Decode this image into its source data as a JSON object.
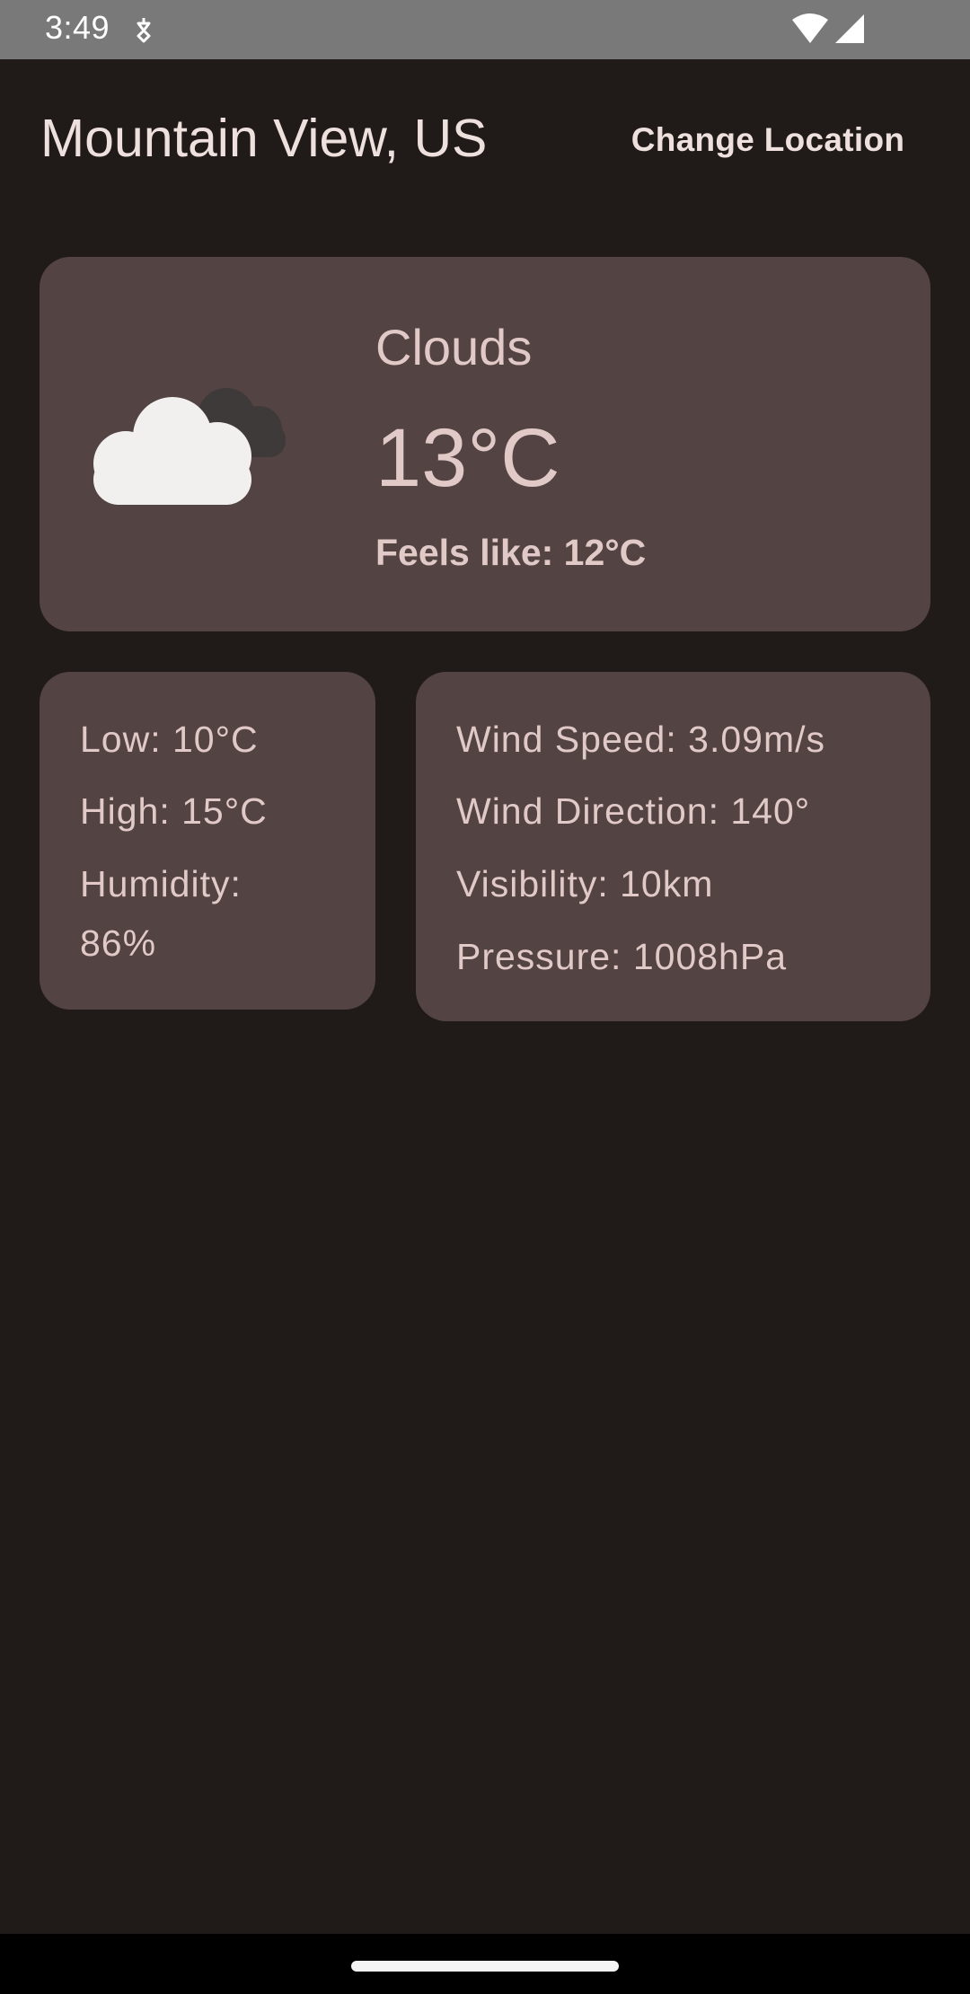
{
  "status_bar": {
    "time": "3:49",
    "icons": [
      "notification-icon",
      "wifi-icon",
      "signal-icon"
    ]
  },
  "header": {
    "location": "Mountain View, US",
    "change_location_label": "Change Location"
  },
  "current": {
    "icon": "clouds-icon",
    "condition": "Clouds",
    "temperature": "13°C",
    "feels_like": "Feels like: 12°C"
  },
  "details_left": {
    "low": "Low: 10°C",
    "high": "High: 15°C",
    "humidity_line1": "Humidity:",
    "humidity_line2": "86%"
  },
  "details_right": {
    "wind_speed": "Wind Speed: 3.09m/s",
    "wind_direction": "Wind Direction: 140°",
    "visibility": "Visibility: 10km",
    "pressure": "Pressure: 1008hPa"
  },
  "colors": {
    "background": "#201a19",
    "card": "#534342",
    "text": "#e0c9c6",
    "title": "#ede0dd",
    "status_bar": "#797979"
  }
}
